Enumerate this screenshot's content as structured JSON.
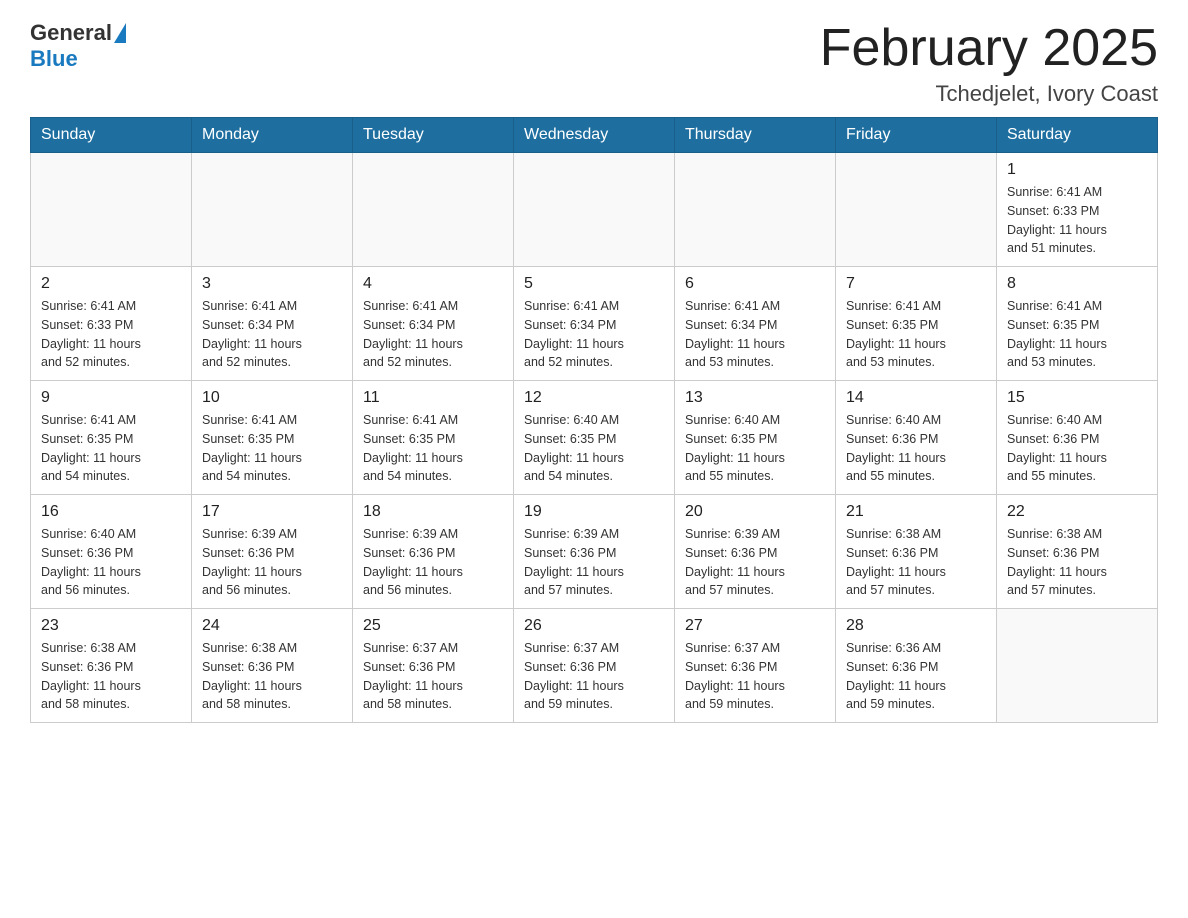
{
  "header": {
    "logo_general": "General",
    "logo_blue": "Blue",
    "month_title": "February 2025",
    "location": "Tchedjelet, Ivory Coast"
  },
  "days_of_week": [
    "Sunday",
    "Monday",
    "Tuesday",
    "Wednesday",
    "Thursday",
    "Friday",
    "Saturday"
  ],
  "weeks": [
    [
      {
        "day": "",
        "info": ""
      },
      {
        "day": "",
        "info": ""
      },
      {
        "day": "",
        "info": ""
      },
      {
        "day": "",
        "info": ""
      },
      {
        "day": "",
        "info": ""
      },
      {
        "day": "",
        "info": ""
      },
      {
        "day": "1",
        "info": "Sunrise: 6:41 AM\nSunset: 6:33 PM\nDaylight: 11 hours\nand 51 minutes."
      }
    ],
    [
      {
        "day": "2",
        "info": "Sunrise: 6:41 AM\nSunset: 6:33 PM\nDaylight: 11 hours\nand 52 minutes."
      },
      {
        "day": "3",
        "info": "Sunrise: 6:41 AM\nSunset: 6:34 PM\nDaylight: 11 hours\nand 52 minutes."
      },
      {
        "day": "4",
        "info": "Sunrise: 6:41 AM\nSunset: 6:34 PM\nDaylight: 11 hours\nand 52 minutes."
      },
      {
        "day": "5",
        "info": "Sunrise: 6:41 AM\nSunset: 6:34 PM\nDaylight: 11 hours\nand 52 minutes."
      },
      {
        "day": "6",
        "info": "Sunrise: 6:41 AM\nSunset: 6:34 PM\nDaylight: 11 hours\nand 53 minutes."
      },
      {
        "day": "7",
        "info": "Sunrise: 6:41 AM\nSunset: 6:35 PM\nDaylight: 11 hours\nand 53 minutes."
      },
      {
        "day": "8",
        "info": "Sunrise: 6:41 AM\nSunset: 6:35 PM\nDaylight: 11 hours\nand 53 minutes."
      }
    ],
    [
      {
        "day": "9",
        "info": "Sunrise: 6:41 AM\nSunset: 6:35 PM\nDaylight: 11 hours\nand 54 minutes."
      },
      {
        "day": "10",
        "info": "Sunrise: 6:41 AM\nSunset: 6:35 PM\nDaylight: 11 hours\nand 54 minutes."
      },
      {
        "day": "11",
        "info": "Sunrise: 6:41 AM\nSunset: 6:35 PM\nDaylight: 11 hours\nand 54 minutes."
      },
      {
        "day": "12",
        "info": "Sunrise: 6:40 AM\nSunset: 6:35 PM\nDaylight: 11 hours\nand 54 minutes."
      },
      {
        "day": "13",
        "info": "Sunrise: 6:40 AM\nSunset: 6:35 PM\nDaylight: 11 hours\nand 55 minutes."
      },
      {
        "day": "14",
        "info": "Sunrise: 6:40 AM\nSunset: 6:36 PM\nDaylight: 11 hours\nand 55 minutes."
      },
      {
        "day": "15",
        "info": "Sunrise: 6:40 AM\nSunset: 6:36 PM\nDaylight: 11 hours\nand 55 minutes."
      }
    ],
    [
      {
        "day": "16",
        "info": "Sunrise: 6:40 AM\nSunset: 6:36 PM\nDaylight: 11 hours\nand 56 minutes."
      },
      {
        "day": "17",
        "info": "Sunrise: 6:39 AM\nSunset: 6:36 PM\nDaylight: 11 hours\nand 56 minutes."
      },
      {
        "day": "18",
        "info": "Sunrise: 6:39 AM\nSunset: 6:36 PM\nDaylight: 11 hours\nand 56 minutes."
      },
      {
        "day": "19",
        "info": "Sunrise: 6:39 AM\nSunset: 6:36 PM\nDaylight: 11 hours\nand 57 minutes."
      },
      {
        "day": "20",
        "info": "Sunrise: 6:39 AM\nSunset: 6:36 PM\nDaylight: 11 hours\nand 57 minutes."
      },
      {
        "day": "21",
        "info": "Sunrise: 6:38 AM\nSunset: 6:36 PM\nDaylight: 11 hours\nand 57 minutes."
      },
      {
        "day": "22",
        "info": "Sunrise: 6:38 AM\nSunset: 6:36 PM\nDaylight: 11 hours\nand 57 minutes."
      }
    ],
    [
      {
        "day": "23",
        "info": "Sunrise: 6:38 AM\nSunset: 6:36 PM\nDaylight: 11 hours\nand 58 minutes."
      },
      {
        "day": "24",
        "info": "Sunrise: 6:38 AM\nSunset: 6:36 PM\nDaylight: 11 hours\nand 58 minutes."
      },
      {
        "day": "25",
        "info": "Sunrise: 6:37 AM\nSunset: 6:36 PM\nDaylight: 11 hours\nand 58 minutes."
      },
      {
        "day": "26",
        "info": "Sunrise: 6:37 AM\nSunset: 6:36 PM\nDaylight: 11 hours\nand 59 minutes."
      },
      {
        "day": "27",
        "info": "Sunrise: 6:37 AM\nSunset: 6:36 PM\nDaylight: 11 hours\nand 59 minutes."
      },
      {
        "day": "28",
        "info": "Sunrise: 6:36 AM\nSunset: 6:36 PM\nDaylight: 11 hours\nand 59 minutes."
      },
      {
        "day": "",
        "info": ""
      }
    ]
  ]
}
